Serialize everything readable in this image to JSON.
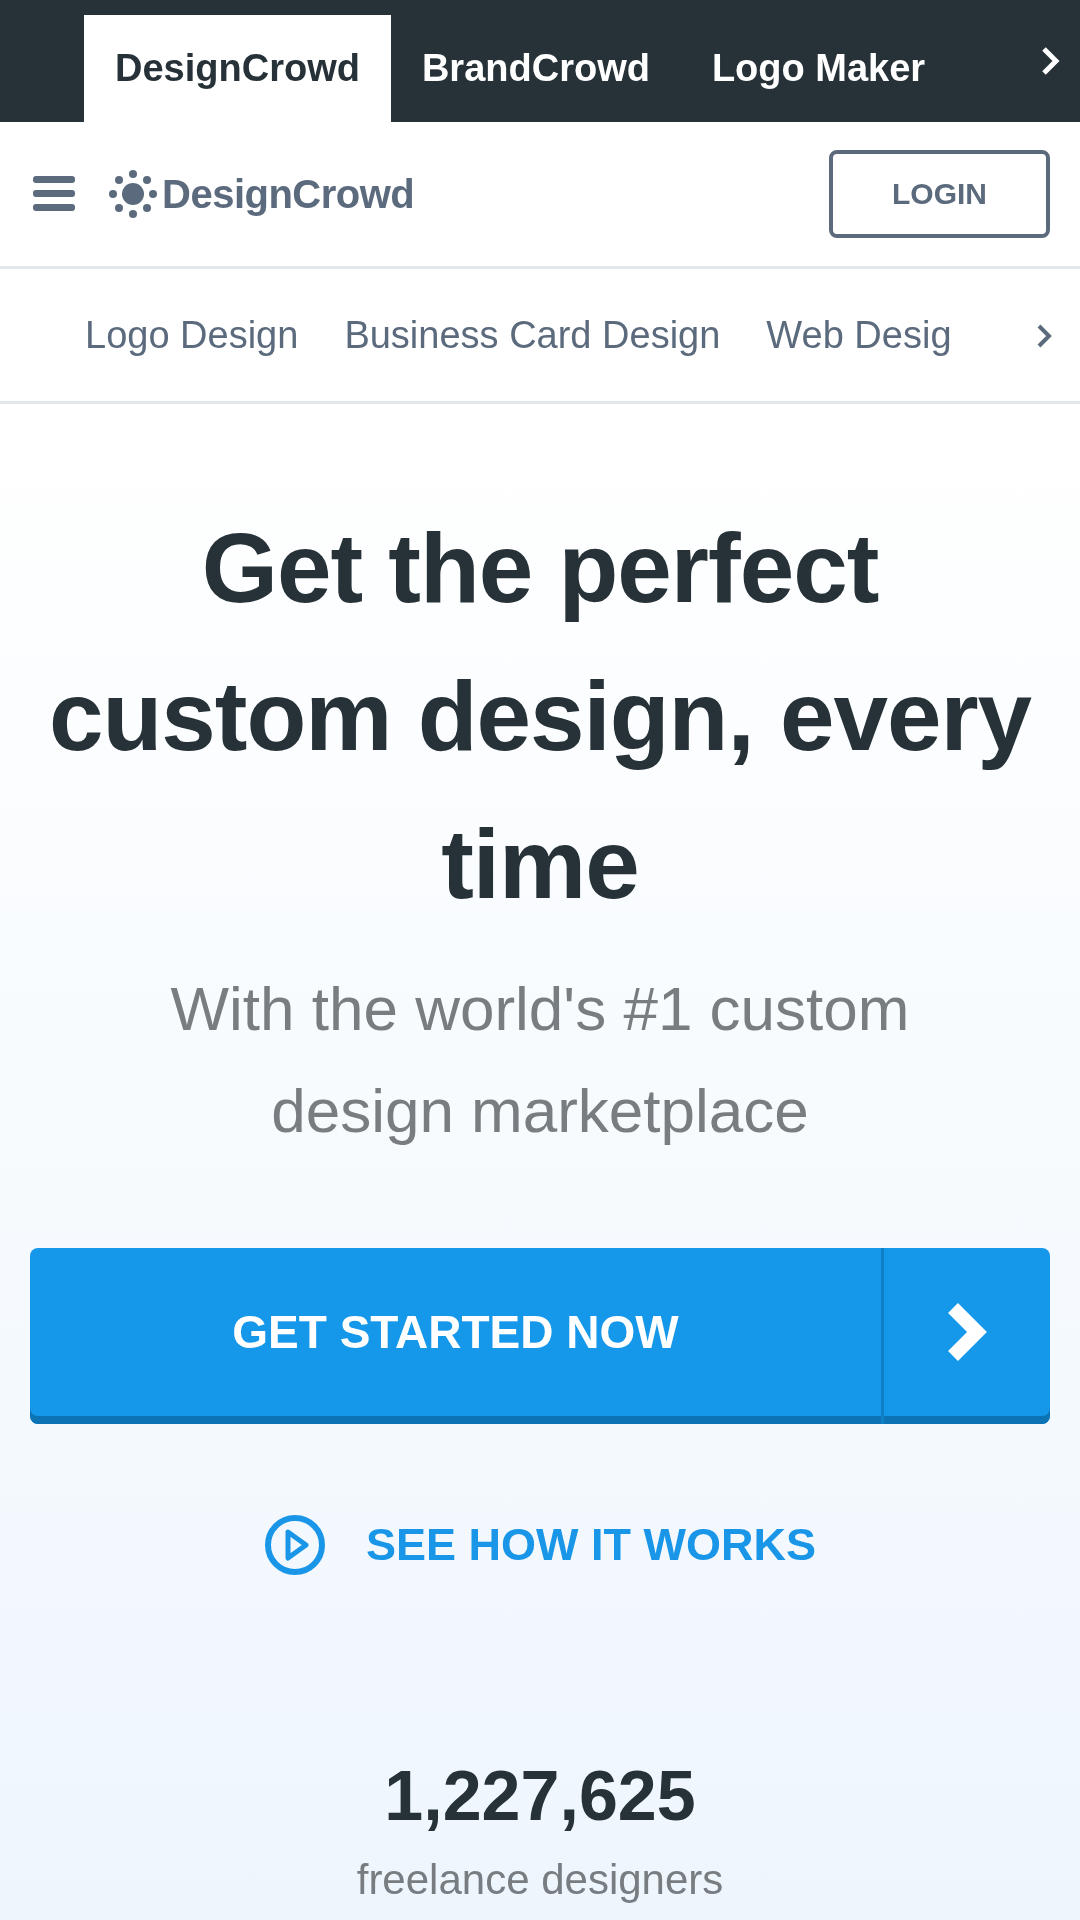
{
  "brand_tabs": [
    {
      "label": "DesignCrowd",
      "selected": true
    },
    {
      "label": "BrandCrowd",
      "selected": false
    },
    {
      "label": "Logo Maker",
      "selected": false
    }
  ],
  "header": {
    "logo": "DesignCrowd",
    "login": "LOGIN"
  },
  "categories": [
    "Logo Design",
    "Business Card Design",
    "Web Desig"
  ],
  "hero": {
    "title": "Get the perfect custom design, every time",
    "subtitle": "With the world's #1 custom design marketplace",
    "cta": "GET STARTED NOW",
    "video_link": "SEE HOW IT WORKS"
  },
  "stat": {
    "value": "1,227,625",
    "label": "freelance designers"
  }
}
